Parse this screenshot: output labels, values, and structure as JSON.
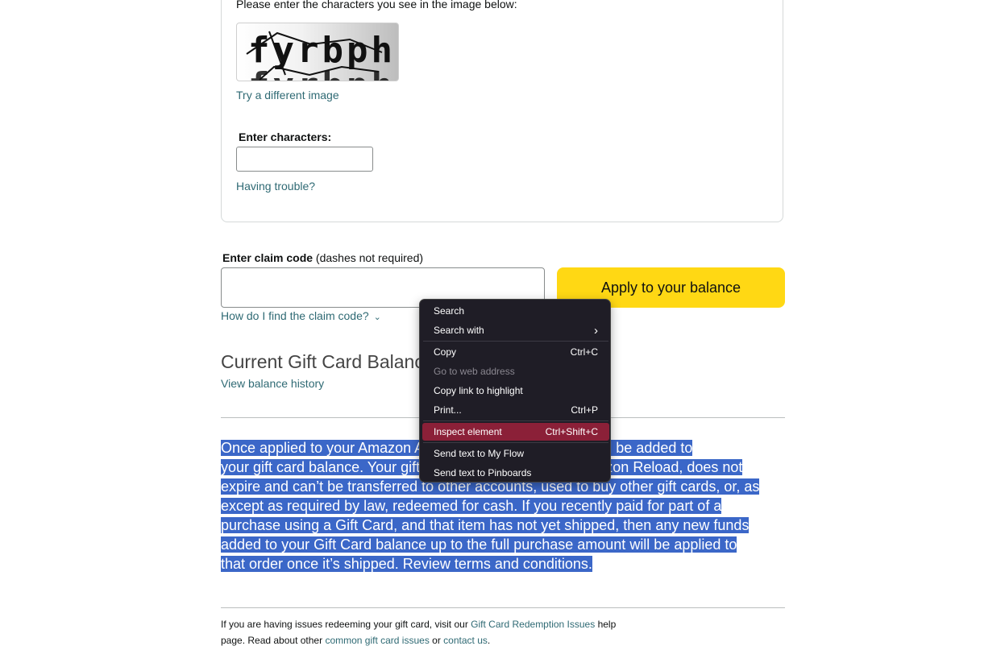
{
  "captcha": {
    "prompt": "Please enter the characters you see in the image below:",
    "image_text": "fyrbph",
    "try_different_label": "Try a different image",
    "enter_label": "Enter characters:",
    "input_value": "",
    "trouble_label": "Having trouble?"
  },
  "claim": {
    "label_bold": "Enter claim code",
    "label_hint": " (dashes not required)",
    "input_value": "",
    "apply_label": "Apply to your balance",
    "find_code_label": "How do I find the claim code?",
    "find_code_icon": "chevron-down-icon"
  },
  "balance": {
    "title": "Current Gift Card Balance",
    "history_label": "View balance history"
  },
  "terms": {
    "lines": [
      "Once applied to your Amazon Account, the entire amount will be added to",
      "your gift card balance. Your gift card balance, including Amazon Reload, does not",
      "expire and can’t be transferred to other accounts, used to buy other gift cards, or, as",
      "except as required by law, redeemed for cash. If you recently paid for part of a",
      "purchase using a Gift Card, and that item has not yet shipped, then any new funds",
      "added to your Gift Card balance up to the full purchase amount will be applied to",
      "that order once it’s shipped. Review terms and conditions."
    ]
  },
  "footer": {
    "part1": "If you are having issues redeeming your gift card, visit our ",
    "redemption_link": "Gift Card Redemption Issues",
    "part2": " help page. Read about other ",
    "common_link": "common gift card issues",
    "part3": " or ",
    "contact_link": "contact us",
    "part4": "."
  },
  "context_menu": {
    "items": [
      {
        "label": "Search",
        "shortcut": ""
      },
      {
        "label": "Search with",
        "shortcut": "›"
      },
      {
        "label": "Copy",
        "shortcut": "Ctrl+C"
      },
      {
        "label": "Go to web address",
        "shortcut": ""
      },
      {
        "label": "Copy link to highlight",
        "shortcut": ""
      },
      {
        "label": "Print...",
        "shortcut": "Ctrl+P"
      },
      {
        "label": "Inspect element",
        "shortcut": "Ctrl+Shift+C"
      },
      {
        "label": "Send text to My Flow",
        "shortcut": ""
      },
      {
        "label": "Send text to Pinboards",
        "shortcut": ""
      }
    ]
  },
  "colors": {
    "link": "#2f6a74",
    "apply_button": "#ffd814",
    "selection": "#3b67c8",
    "menu_bg": "#1f1d26",
    "menu_highlight": "#8b2038"
  }
}
